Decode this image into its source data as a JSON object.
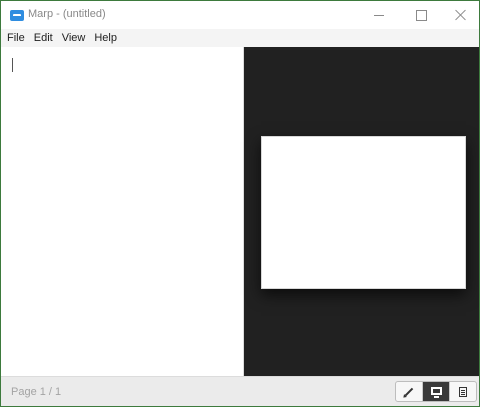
{
  "window": {
    "title": "Marp - (untitled)",
    "app_icon": "marp-app-icon",
    "controls": {
      "minimize_icon": "minimize-icon",
      "maximize_icon": "maximize-icon",
      "close_icon": "close-icon"
    }
  },
  "menu": {
    "items": [
      {
        "label": "File"
      },
      {
        "label": "Edit"
      },
      {
        "label": "View"
      },
      {
        "label": "Help"
      }
    ]
  },
  "editor": {
    "value": ""
  },
  "preview": {
    "background": "#212121",
    "slide_background": "#ffffff"
  },
  "status": {
    "page_indicator": "Page 1 / 1"
  },
  "view_modes": [
    {
      "icon": "pencil-icon",
      "active": false
    },
    {
      "icon": "monitor-icon",
      "active": true
    },
    {
      "icon": "document-icon",
      "active": false
    }
  ]
}
